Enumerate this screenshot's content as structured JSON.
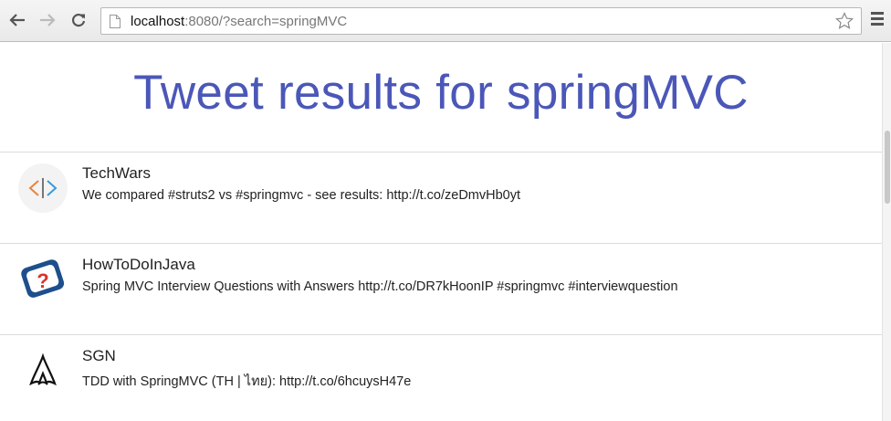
{
  "browser": {
    "url_host": "localhost",
    "url_rest": ":8080/?search=springMVC"
  },
  "page": {
    "title": "Tweet results for springMVC"
  },
  "tweets": [
    {
      "author": "TechWars",
      "text": "We compared #struts2 vs #springmvc - see results: http://t.co/zeDmvHb0yt",
      "avatar_icon": "code-brackets-icon"
    },
    {
      "author": "HowToDoInJava",
      "text": "Spring MVC Interview Questions with Answers http://t.co/DR7kHoonIP #springmvc #interviewquestion",
      "avatar_icon": "question-mark-icon"
    },
    {
      "author": "SGN",
      "text": "TDD with SpringMVC (TH | ไทย): http://t.co/6hcuysH47e",
      "avatar_icon": "assassin-logo-icon"
    }
  ],
  "colors": {
    "title": "#4b57b8",
    "avatar_orange": "#e8843a",
    "avatar_blue": "#3a9bd9",
    "avatar_red": "#d9322b",
    "avatar_navy": "#1e4f8c"
  }
}
